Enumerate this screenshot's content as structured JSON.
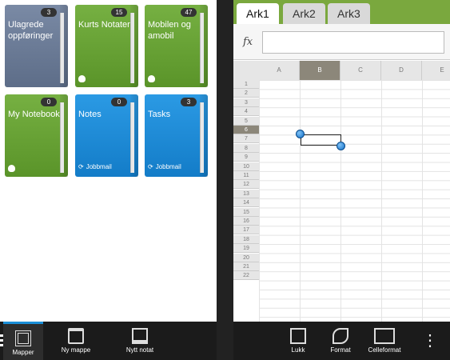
{
  "folders": [
    {
      "name": "Ulagrede oppføringer",
      "count": "3",
      "color": "#6a7a96",
      "footer": ""
    },
    {
      "name": "Kurts Notater",
      "count": "15",
      "color": "#6aa535",
      "footer": "elephant"
    },
    {
      "name": "Mobilen og amobil",
      "count": "47",
      "color": "#6aa535",
      "footer": "elephant"
    },
    {
      "name": "My Notebook",
      "count": "0",
      "color": "#6aa535",
      "footer": "elephant"
    },
    {
      "name": "Notes",
      "count": "0",
      "color": "#1a8ad8",
      "footer": "Jobbmail"
    },
    {
      "name": "Tasks",
      "count": "3",
      "color": "#1a8ad8",
      "footer": "Jobbmail"
    }
  ],
  "left_bar": {
    "mapper": "Mapper",
    "ny_mappe": "Ny mappe",
    "nytt_notat": "Nytt notat"
  },
  "sheet": {
    "tabs": [
      "Ark1",
      "Ark2",
      "Ark3"
    ],
    "fx_label": "fx",
    "formula_value": "",
    "columns": [
      "A",
      "B",
      "C",
      "D",
      "E"
    ],
    "rows": [
      "1",
      "2",
      "3",
      "4",
      "5",
      "6",
      "7",
      "8",
      "9",
      "10",
      "11",
      "12",
      "13",
      "14",
      "15",
      "16",
      "17",
      "18",
      "19",
      "20",
      "21",
      "22"
    ],
    "selected_column": "B",
    "selected_row": "6"
  },
  "right_bar": {
    "lukk": "Lukk",
    "format": "Format",
    "celleformat": "Celleformat",
    "more": "⋮"
  }
}
